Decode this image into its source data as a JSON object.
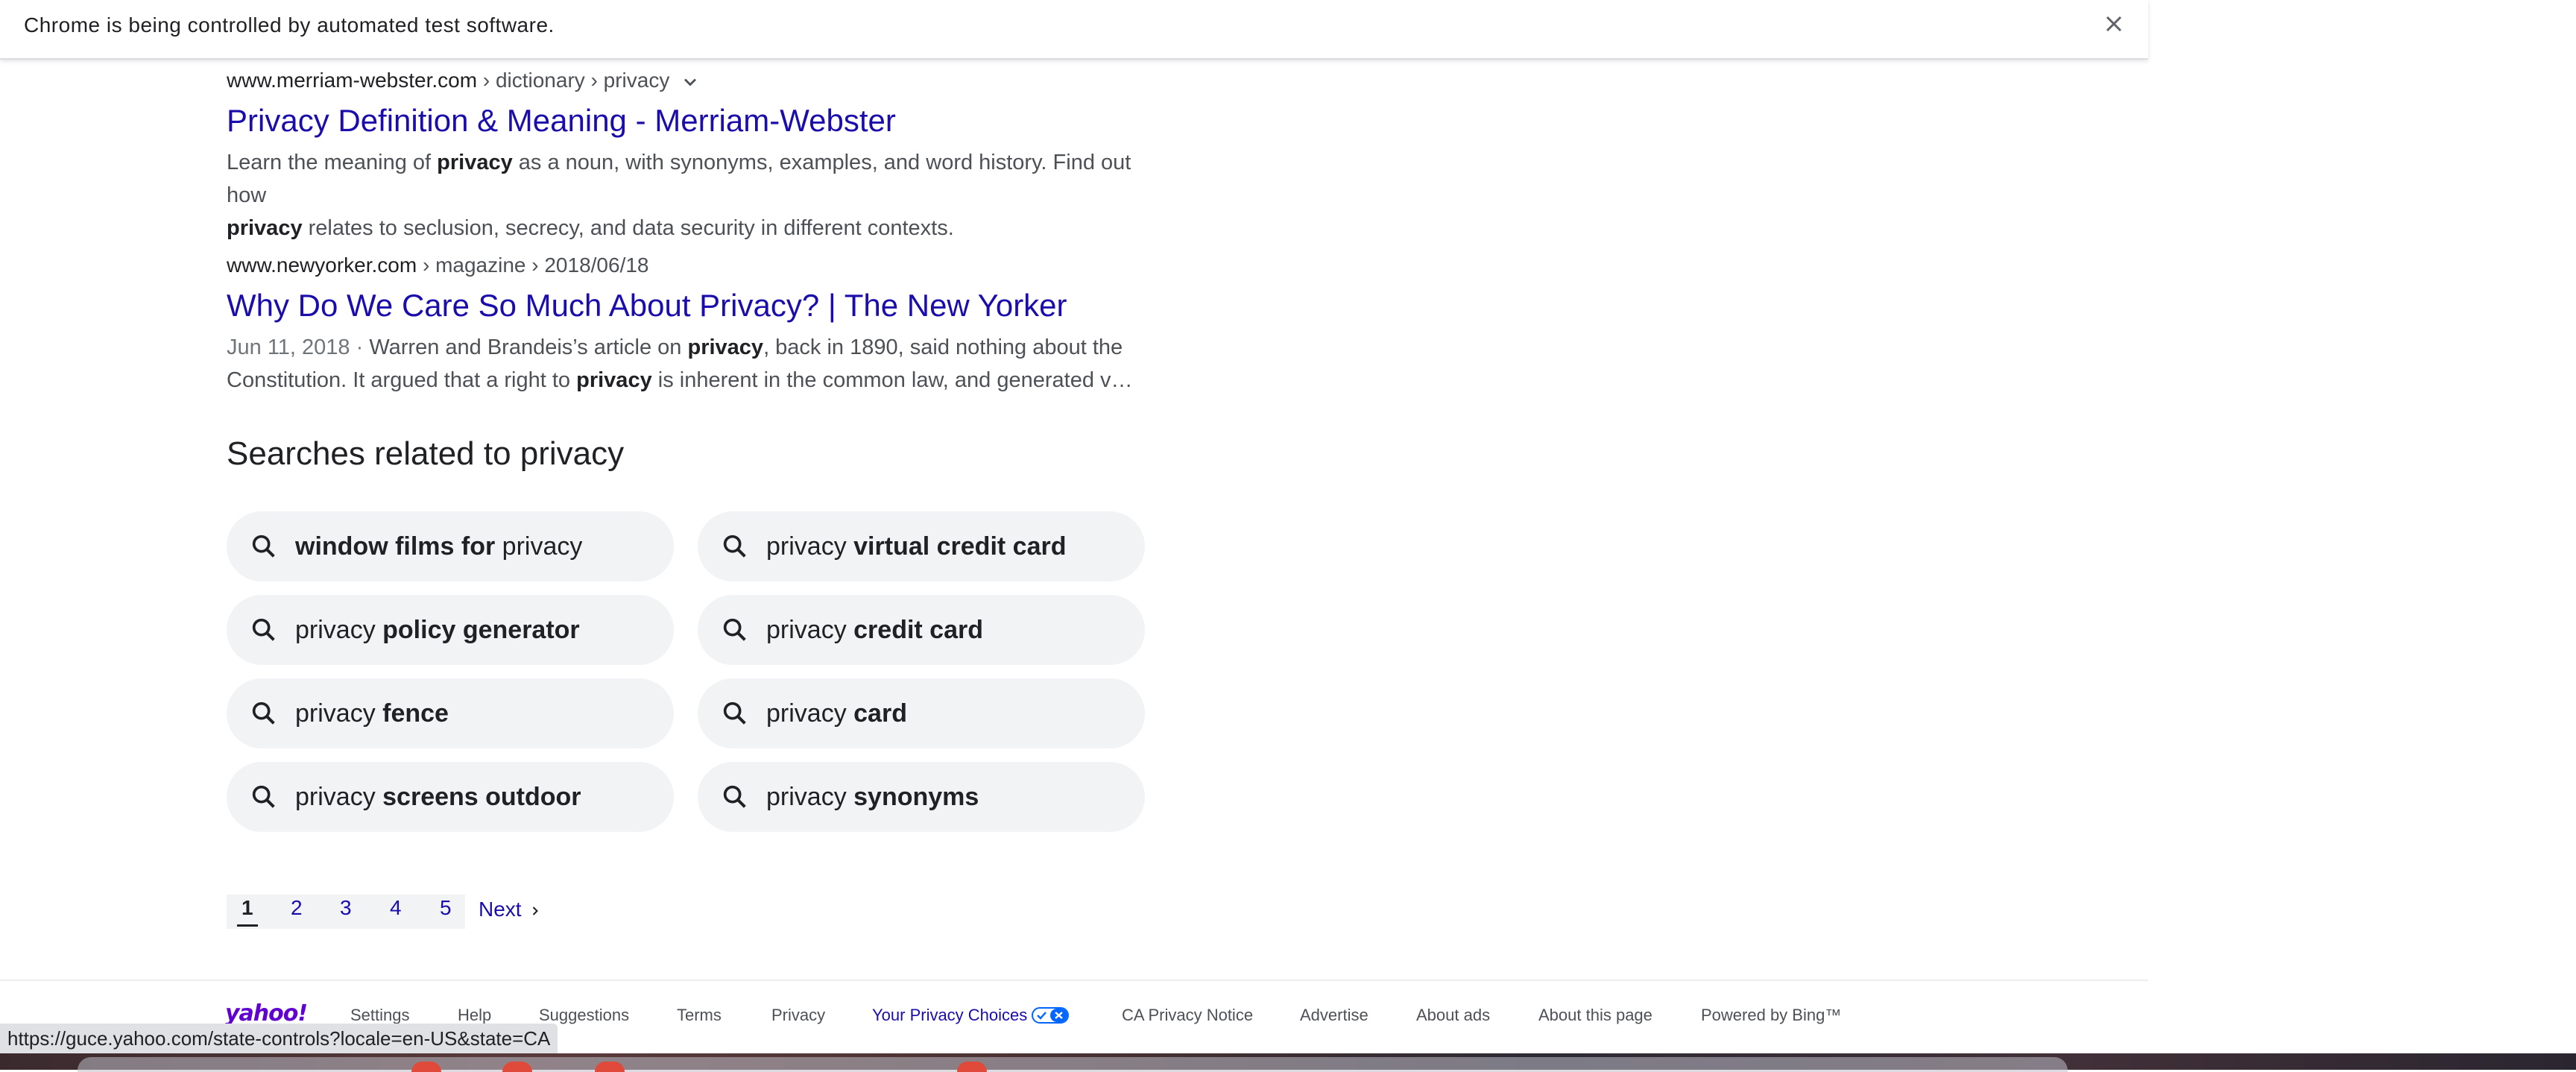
{
  "infobar": {
    "message": "Chrome is being controlled by automated test software.",
    "close_icon": "close-icon"
  },
  "results": [
    {
      "domain": "www.merriam-webster.com",
      "path": " › dictionary › privacy",
      "title": "Privacy Definition & Meaning - Merriam-Webster",
      "snippet_parts": {
        "l1a": "Learn the meaning of ",
        "l1b": "privacy",
        "l1c": " as a noun, with synonyms, examples, and word history. Find out how",
        "l2a": "privacy",
        "l2b": " relates to seclusion, secrecy, and data security in different contexts."
      }
    },
    {
      "domain": "www.newyorker.com",
      "path": " › magazine › 2018/06/18",
      "title": "Why Do We Care So Much About Privacy? | The New Yorker",
      "snippet_parts": {
        "date": "Jun 11, 2018 · ",
        "l1a": "Warren and Brandeis’s article on ",
        "l1b": "privacy",
        "l1c": ", back in 1890, said nothing about the",
        "l2a": "Constitution. It argued that a right to ",
        "l2b": "privacy",
        "l2c": " is inherent in the common law, and generated various…"
      }
    }
  ],
  "related": {
    "title": "Searches related to privacy",
    "chips": [
      {
        "pre": "",
        "bold": "window films for",
        "post": " privacy"
      },
      {
        "pre": "privacy ",
        "bold": "virtual credit card",
        "post": ""
      },
      {
        "pre": "privacy ",
        "bold": "policy generator",
        "post": ""
      },
      {
        "pre": "privacy ",
        "bold": "credit card",
        "post": ""
      },
      {
        "pre": "privacy ",
        "bold": "fence",
        "post": ""
      },
      {
        "pre": "privacy ",
        "bold": "card",
        "post": ""
      },
      {
        "pre": "privacy ",
        "bold": "screens outdoor",
        "post": ""
      },
      {
        "pre": "privacy ",
        "bold": "synonyms",
        "post": ""
      }
    ]
  },
  "pagination": {
    "pages": [
      "1",
      "2",
      "3",
      "4",
      "5"
    ],
    "current": "1",
    "next": "Next"
  },
  "footer": {
    "logo": "yahoo!",
    "links": {
      "settings": "Settings",
      "help": "Help",
      "suggestions": "Suggestions",
      "terms": "Terms",
      "privacy": "Privacy",
      "your_privacy_choices": "Your Privacy Choices",
      "ca_privacy": "CA Privacy Notice",
      "advertise": "Advertise",
      "about_ads": "About ads",
      "about_page": "About this page",
      "powered": "Powered by Bing™"
    }
  },
  "status_url": "https://guce.yahoo.com/state-controls?locale=en-US&state=CA",
  "colors": {
    "link": "#1a0dab",
    "chip_bg": "#f1f3f4",
    "yahoo_purple": "#6001d2"
  }
}
